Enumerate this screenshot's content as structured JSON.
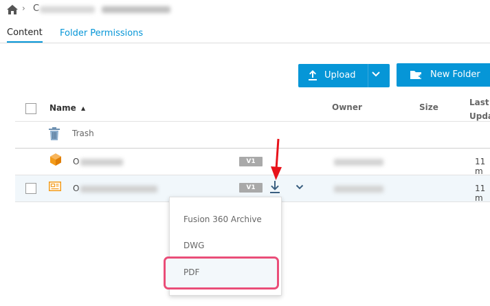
{
  "breadcrumb": {
    "first_initial": "C",
    "separator": "›"
  },
  "tabs": [
    {
      "label": "Content",
      "active": true
    },
    {
      "label": "Folder Permissions",
      "active": false
    }
  ],
  "toolbar": {
    "upload_label": "Upload",
    "new_folder_label": "New Folder"
  },
  "table": {
    "columns": {
      "name": "Name",
      "sort_indicator": "▲",
      "owner": "Owner",
      "size": "Size",
      "last_updated_line1": "Last",
      "last_updated_line2": "Upda"
    },
    "rows": [
      {
        "name": "Trash",
        "type": "trash-folder"
      },
      {
        "name_prefix": "O",
        "version": "V1",
        "date": "11 m",
        "type": "fusion-design"
      },
      {
        "name_prefix": "O",
        "version": "V1",
        "date": "11 m",
        "type": "drawing",
        "selected": true
      }
    ]
  },
  "download_menu": {
    "items": [
      "Fusion 360 Archive",
      "DWG",
      "PDF"
    ],
    "highlighted_item": "PDF"
  },
  "colors": {
    "accent": "#0696d7",
    "annotation_red": "#e8121a",
    "highlight_pink": "#ea4d78",
    "version_badge": "#a9a9a9",
    "fusion_orange": "#f39b1a"
  }
}
